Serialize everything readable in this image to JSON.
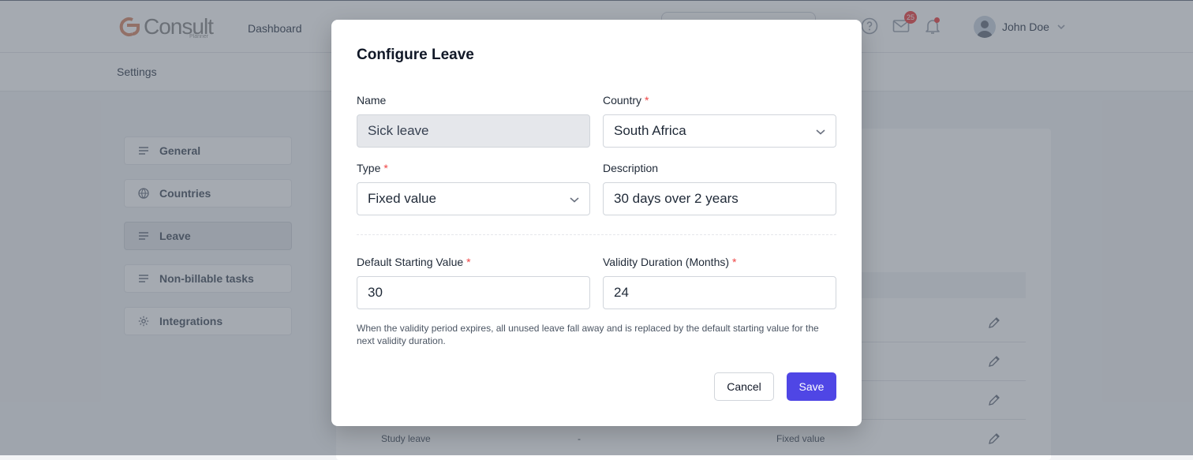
{
  "app": {
    "logo_text": "Consult",
    "logo_sub": "Planner",
    "nav_dashboard": "Dashboard",
    "notification_count": "25",
    "user_name": "John Doe",
    "page_title": "Settings"
  },
  "sidebar": {
    "items": [
      {
        "label": "General",
        "icon": "list-icon"
      },
      {
        "label": "Countries",
        "icon": "globe-icon"
      },
      {
        "label": "Leave",
        "icon": "list-icon",
        "active": true
      },
      {
        "label": "Non-billable tasks",
        "icon": "list-icon"
      },
      {
        "label": "Integrations",
        "icon": "gear-icon"
      }
    ]
  },
  "table": {
    "last_row": {
      "name": "Study leave",
      "country": "-",
      "type": "Fixed value"
    }
  },
  "modal": {
    "title": "Configure Leave",
    "name_label": "Name",
    "name_value": "Sick leave",
    "country_label": "Country",
    "country_value": "South Africa",
    "type_label": "Type",
    "type_value": "Fixed value",
    "description_label": "Description",
    "description_value": "30 days over 2 years",
    "default_label": "Default Starting Value",
    "default_value": "30",
    "validity_label": "Validity Duration (Months)",
    "validity_value": "24",
    "required_mark": "*",
    "helper_text": "When the validity period expires, all unused leave fall away and is replaced by the default starting value for the next validity duration.",
    "cancel_label": "Cancel",
    "save_label": "Save"
  },
  "colors": {
    "primary": "#4f46e5",
    "required": "#ef4444",
    "overlay": "rgba(75,85,99,0.5)"
  }
}
